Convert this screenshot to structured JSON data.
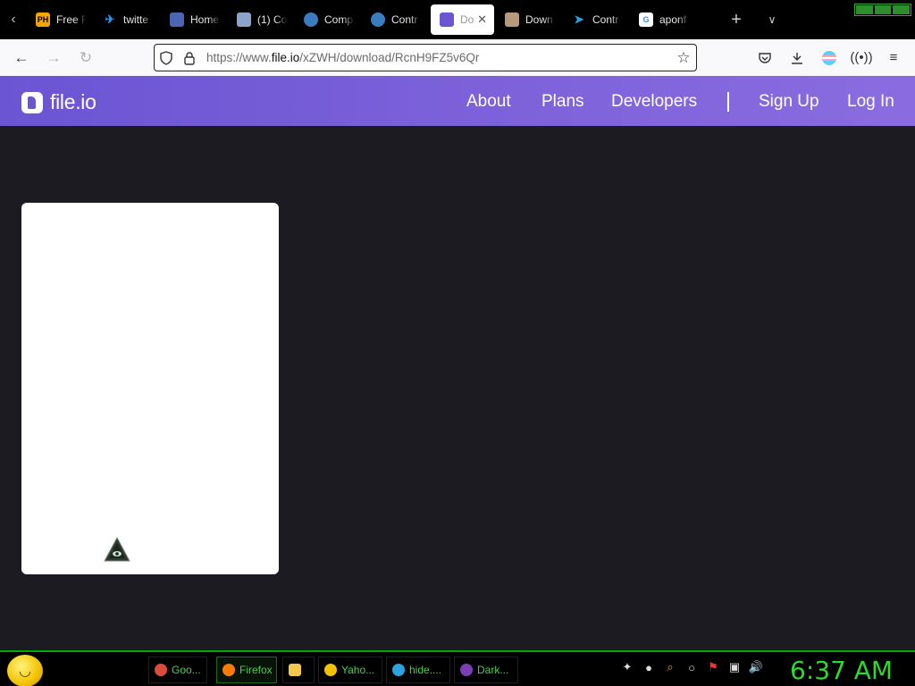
{
  "browser": {
    "tabs": [
      {
        "label": "Free F",
        "icon": "ph-icon",
        "color": "#f7a600",
        "text": "PH"
      },
      {
        "label": "twitte",
        "icon": "twitter-icon",
        "color": "#1d9bf0",
        "text": ""
      },
      {
        "label": "Home",
        "icon": "site-icon",
        "color": "#4a67b3",
        "text": ""
      },
      {
        "label": "(1) Co",
        "icon": "site-icon",
        "color": "#8ea3c9",
        "text": ""
      },
      {
        "label": "Comp",
        "icon": "globe-icon",
        "color": "#3a7dbf",
        "text": ""
      },
      {
        "label": "Contr",
        "icon": "globe-icon",
        "color": "#3a7dbf",
        "text": ""
      },
      {
        "label": "Do",
        "icon": "fileio-icon",
        "color": "#6b55d3",
        "text": "",
        "active": true
      },
      {
        "label": "Down",
        "icon": "avatar-icon",
        "color": "#b79a7c",
        "text": ""
      },
      {
        "label": "Contr",
        "icon": "telegram-icon",
        "color": "#2aa3e0",
        "text": ""
      },
      {
        "label": "aponf",
        "icon": "google-icon",
        "color": "#ffffff",
        "text": "G"
      }
    ],
    "url": {
      "prefix": "https://www.",
      "host": "file.io",
      "path": "/xZWH/download/RcnH9FZ5v6Qr"
    }
  },
  "site": {
    "logo_text": "file.io",
    "nav": {
      "about": "About",
      "plans": "Plans",
      "developers": "Developers",
      "signup": "Sign Up",
      "login": "Log In"
    },
    "accent": "#6b55d3"
  },
  "taskbar": {
    "tasks": [
      {
        "label": "Goo...",
        "icon": "chrome-icon",
        "color": "#dd4b39"
      },
      {
        "label": "Firefox",
        "icon": "firefox-icon",
        "color": "#ff7a00",
        "active": true
      },
      {
        "label": "",
        "icon": "folder-icon",
        "color": "#f2c94c"
      },
      {
        "label": "Yaho...",
        "icon": "emoji-icon",
        "color": "#f2c200"
      },
      {
        "label": "hide....",
        "icon": "telegram-icon",
        "color": "#2aa3e0"
      },
      {
        "label": "Dark...",
        "icon": "tor-icon",
        "color": "#7b3fb5"
      }
    ],
    "clock": "6:37 AM"
  }
}
